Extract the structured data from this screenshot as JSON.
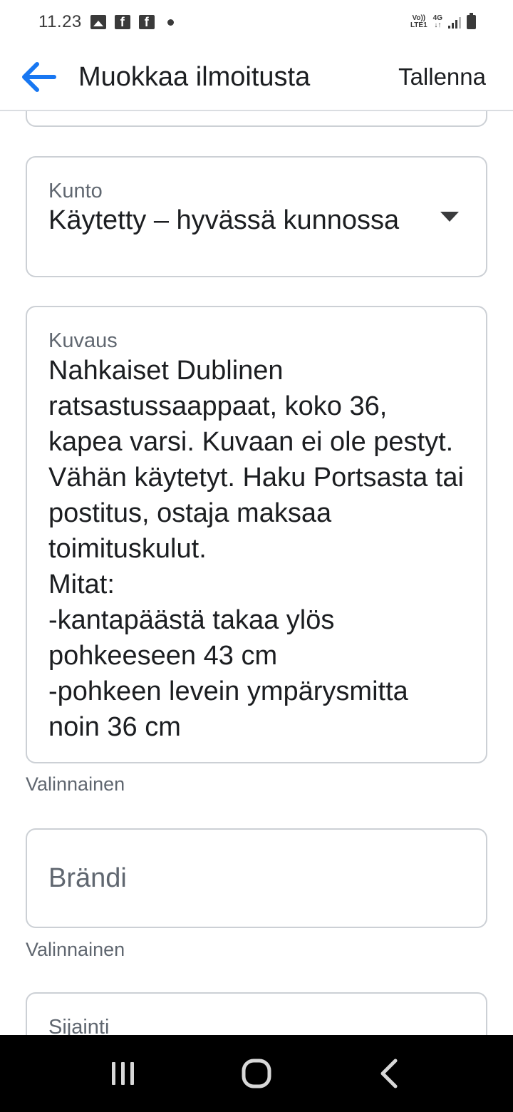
{
  "status_bar": {
    "time": "11.23",
    "volte_line1": "Vo))",
    "volte_line2": "LTE1",
    "network_line1": "4G",
    "network_line2": "↓↑"
  },
  "app_bar": {
    "title": "Muokkaa ilmoitusta",
    "save_label": "Tallenna"
  },
  "form": {
    "condition": {
      "label": "Kunto",
      "value": "Käytetty – hyvässä kunnossa"
    },
    "description": {
      "label": "Kuvaus",
      "value": "Nahkaiset Dublinen ratsastussaappaat, koko 36, kapea varsi. Kuvaan ei ole pestyt. Vähän käytetyt. Haku Portsasta tai postitus, ostaja maksaa toimituskulut.\nMitat:\n-kantapäästä takaa ylös pohkeeseen 43 cm\n-pohkeen levein ympärysmitta noin 36 cm",
      "helper": "Valinnainen"
    },
    "brand": {
      "placeholder": "Brändi",
      "helper": "Valinnainen"
    },
    "location": {
      "label": "Sijainti"
    }
  },
  "colors": {
    "accent": "#1877f2",
    "border": "#ccd0d5",
    "secondary_text": "#606770",
    "primary_text": "#1c1e21"
  }
}
